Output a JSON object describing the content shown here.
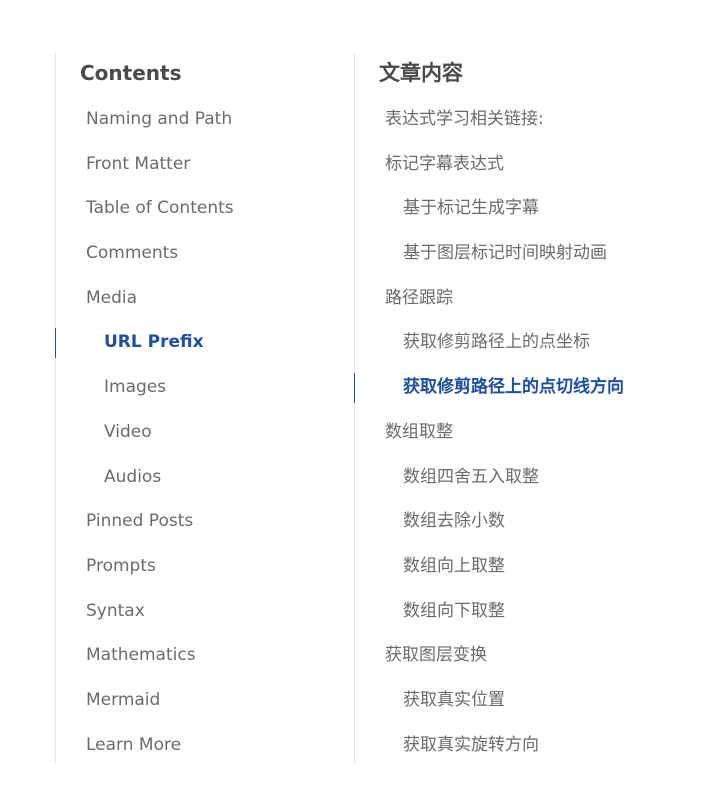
{
  "toc_left": {
    "title": "Contents",
    "items": [
      {
        "label": "Naming and Path",
        "level": 1,
        "active": false
      },
      {
        "label": "Front Matter",
        "level": 1,
        "active": false
      },
      {
        "label": "Table of Contents",
        "level": 1,
        "active": false
      },
      {
        "label": "Comments",
        "level": 1,
        "active": false
      },
      {
        "label": "Media",
        "level": 1,
        "active": false
      },
      {
        "label": "URL Prefix",
        "level": 2,
        "active": true
      },
      {
        "label": "Images",
        "level": 2,
        "active": false
      },
      {
        "label": "Video",
        "level": 2,
        "active": false
      },
      {
        "label": "Audios",
        "level": 2,
        "active": false
      },
      {
        "label": "Pinned Posts",
        "level": 1,
        "active": false
      },
      {
        "label": "Prompts",
        "level": 1,
        "active": false
      },
      {
        "label": "Syntax",
        "level": 1,
        "active": false
      },
      {
        "label": "Mathematics",
        "level": 1,
        "active": false
      },
      {
        "label": "Mermaid",
        "level": 1,
        "active": false
      },
      {
        "label": "Learn More",
        "level": 1,
        "active": false
      }
    ]
  },
  "toc_right": {
    "title": "文章内容",
    "items": [
      {
        "label": "表达式学习相关链接:",
        "level": 1,
        "active": false
      },
      {
        "label": "标记字幕表达式",
        "level": 1,
        "active": false
      },
      {
        "label": "基于标记生成字幕",
        "level": 2,
        "active": false
      },
      {
        "label": "基于图层标记时间映射动画",
        "level": 2,
        "active": false
      },
      {
        "label": "路径跟踪",
        "level": 1,
        "active": false
      },
      {
        "label": "获取修剪路径上的点坐标",
        "level": 2,
        "active": false
      },
      {
        "label": "获取修剪路径上的点切线方向",
        "level": 2,
        "active": true
      },
      {
        "label": "数组取整",
        "level": 1,
        "active": false
      },
      {
        "label": "数组四舍五入取整",
        "level": 2,
        "active": false
      },
      {
        "label": "数组去除小数",
        "level": 2,
        "active": false
      },
      {
        "label": "数组向上取整",
        "level": 2,
        "active": false
      },
      {
        "label": "数组向下取整",
        "level": 2,
        "active": false
      },
      {
        "label": "获取图层变换",
        "level": 1,
        "active": false
      },
      {
        "label": "获取真实位置",
        "level": 2,
        "active": false
      },
      {
        "label": "获取真实旋转方向",
        "level": 2,
        "active": false
      }
    ]
  },
  "colors": {
    "text": "#6b6b6b",
    "title": "#4a4a4a",
    "active": "#1f4fa0",
    "border": "#e6e6e6"
  }
}
